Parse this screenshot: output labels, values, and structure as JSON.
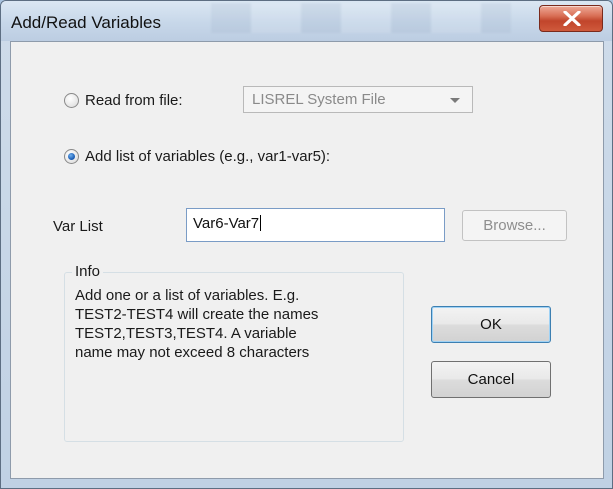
{
  "window": {
    "title": "Add/Read Variables"
  },
  "read_from_file": {
    "label": "Read from file:",
    "checked": false,
    "dropdown_value": "LISREL System File"
  },
  "add_list": {
    "label": "Add list of variables (e.g., var1-var5):",
    "checked": true
  },
  "var_list": {
    "label": "Var List",
    "value": "Var6-Var7",
    "browse_label": "Browse..."
  },
  "info": {
    "legend": "Info",
    "lines": [
      "Add one or a  list of variables.  E.g.",
      "TEST2-TEST4 will create the names",
      "TEST2,TEST3,TEST4.  A variable",
      "name may not exceed 8 characters"
    ]
  },
  "buttons": {
    "ok_label": "OK",
    "cancel_label": "Cancel"
  },
  "colors": {
    "accent": "#3c7fb1",
    "close_button": "#c94a30"
  }
}
